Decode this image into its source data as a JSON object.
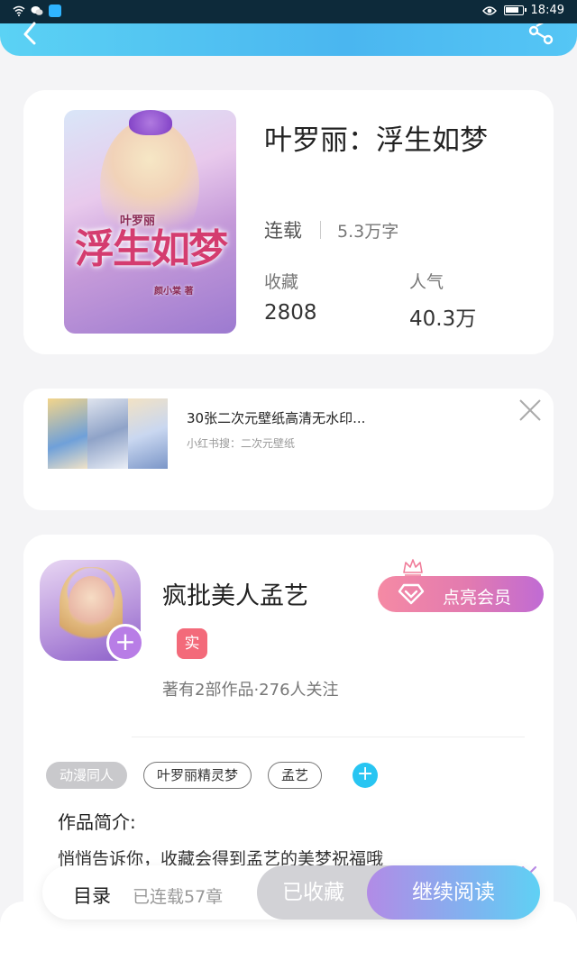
{
  "status_bar": {
    "time": "18:49"
  },
  "book": {
    "cover": {
      "subtitle": "叶罗丽",
      "title": "浮生如梦",
      "author": "颜小棠 著"
    },
    "title": "叶罗丽：浮生如梦",
    "status": "连载",
    "word_count": "5.3万字",
    "favorites_label": "收藏",
    "favorites_value": "2808",
    "popularity_label": "人气",
    "popularity_value": "40.3万"
  },
  "ad": {
    "title": "30张二次元壁纸高清无水印...",
    "subtitle": "小红书搜：二次元壁纸"
  },
  "author": {
    "name": "疯批美人孟艺",
    "badge": "实",
    "meta": "著有2部作品·276人关注",
    "vip_label": "点亮会员",
    "follow_symbol": "+"
  },
  "tags": [
    "动漫同人",
    "叶罗丽精灵梦",
    "孟艺"
  ],
  "add_tag_symbol": "+",
  "intro": {
    "label": "作品简介:",
    "text": "悄悄告诉你，收藏会得到孟艺的美梦祝福哦"
  },
  "bottom_bar": {
    "toc_label": "目录",
    "toc_progress": "已连载57章",
    "collected_label": "已收藏",
    "read_label": "继续阅读"
  },
  "colors": {
    "accent": "#4ab6f0",
    "vip": "#e27ab0",
    "badge": "#f36a7a"
  },
  "icons": [
    "back-icon",
    "share-icon",
    "close-icon",
    "crown-icon",
    "diamond-icon",
    "expand-icon"
  ]
}
